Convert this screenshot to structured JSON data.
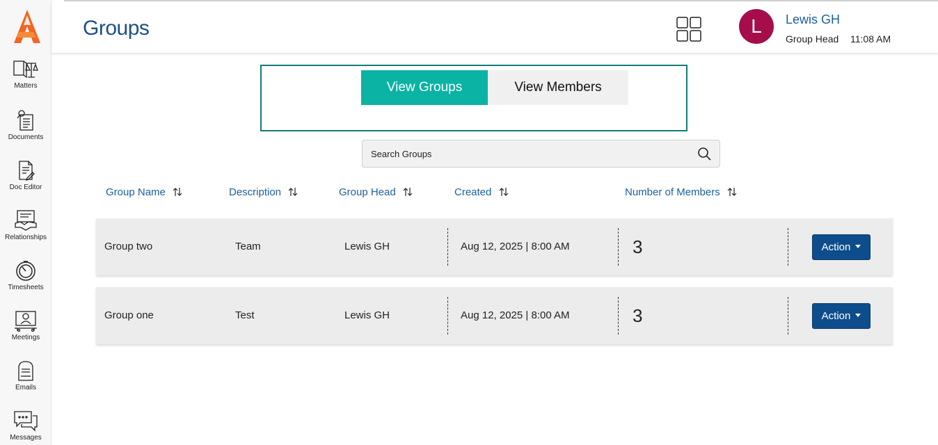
{
  "header": {
    "title": "Groups",
    "user": {
      "initial": "L",
      "name": "Lewis GH",
      "role": "Group Head",
      "time": "11:08 AM"
    }
  },
  "sidebar": {
    "items": [
      {
        "label": "Matters",
        "icon": "scales-book-icon"
      },
      {
        "label": "Documents",
        "icon": "document-pin-icon"
      },
      {
        "label": "Doc Editor",
        "icon": "doc-edit-icon"
      },
      {
        "label": "Relationships",
        "icon": "handshake-icon"
      },
      {
        "label": "Timesheets",
        "icon": "timer-icon"
      },
      {
        "label": "Meetings",
        "icon": "meeting-icon"
      },
      {
        "label": "Emails",
        "icon": "mailbox-icon"
      },
      {
        "label": "Messages",
        "icon": "chat-icon"
      }
    ]
  },
  "tabs": {
    "groups": "View Groups",
    "members": "View Members"
  },
  "search": {
    "placeholder": "Search Groups"
  },
  "table": {
    "columns": [
      "Group Name",
      "Description",
      "Group Head",
      "Created",
      "Number of Members"
    ],
    "rows": [
      {
        "name": "Group two",
        "description": "Team",
        "head": "Lewis GH",
        "created": "Aug 12, 2025 | 8:00 AM",
        "members": "3",
        "action": "Action"
      },
      {
        "name": "Group one",
        "description": "Test",
        "head": "Lewis GH",
        "created": "Aug 12, 2025 | 8:00 AM",
        "members": "3",
        "action": "Action"
      }
    ]
  },
  "colors": {
    "primary": "#1b4f8a",
    "accent": "#0ab3a3",
    "avatar": "#a50d4b",
    "action": "#0e4d8c",
    "logo": "#f26522"
  }
}
